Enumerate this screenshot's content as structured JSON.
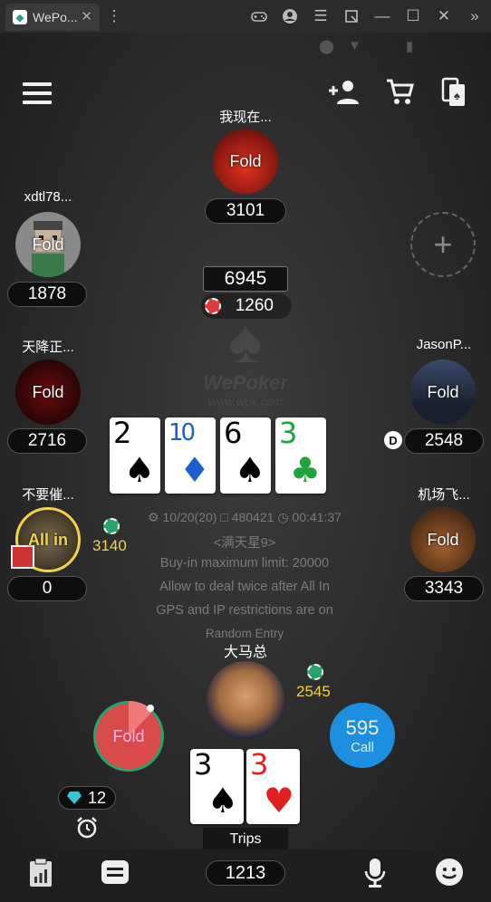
{
  "window": {
    "tab_title": "WePo...",
    "tab_close": "✕"
  },
  "top_icons": {
    "menu": "menu-icon",
    "add_friend": "add-friend-icon",
    "shop": "cart-icon",
    "cards": "cards-icon"
  },
  "pot": {
    "total": "6945",
    "current": "1260"
  },
  "watermark": {
    "brand": "WePoker",
    "url": "www.wpk.com"
  },
  "board": [
    {
      "rank": "2",
      "suit": "♠",
      "color": "#000"
    },
    {
      "rank": "10",
      "suit": "♦",
      "color": "#1a5fd0"
    },
    {
      "rank": "6",
      "suit": "♠",
      "color": "#000"
    },
    {
      "rank": "3",
      "suit": "♣",
      "color": "#1ea43c"
    }
  ],
  "table_info": {
    "hands": "10/20(20)",
    "room_id": "480421",
    "time": "00:41:37",
    "name": "<满天星9>",
    "line1": "Buy-in maximum limit: 20000",
    "line2": "Allow to deal twice after All In",
    "line3": "GPS and IP restrictions are on",
    "line4": "Random Entry"
  },
  "players": {
    "top": {
      "name": "我现在...",
      "status": "Fold",
      "chips": "3101"
    },
    "left1": {
      "name": "xdtl78...",
      "status": "Fold",
      "chips": "1878"
    },
    "left2": {
      "name": "天降正...",
      "status": "Fold",
      "chips": "2716"
    },
    "left3": {
      "name": "不要催...",
      "status": "All in",
      "chips": "0",
      "bet": "3140"
    },
    "right1": {
      "name": "JasonP...",
      "status": "Fold",
      "chips": "2548",
      "dealer": "D"
    },
    "right2": {
      "name": "机场飞...",
      "status": "Fold",
      "chips": "3343"
    },
    "hero": {
      "name": "大马总",
      "bet": "2545",
      "chips": "1213",
      "hand_label": "Trips"
    }
  },
  "empty_seat": "+",
  "hero_cards": [
    {
      "rank": "3",
      "suit": "♠",
      "color": "#000"
    },
    {
      "rank": "3",
      "suit": "♥",
      "color": "#e02020"
    }
  ],
  "actions": {
    "fold": "Fold",
    "call_amount": "595",
    "call_label": "Call"
  },
  "diamonds": "12",
  "bottom_icons": {
    "stats": "stats-icon",
    "chat": "chat-icon",
    "mic": "mic-icon",
    "emoji": "emoji-icon"
  }
}
